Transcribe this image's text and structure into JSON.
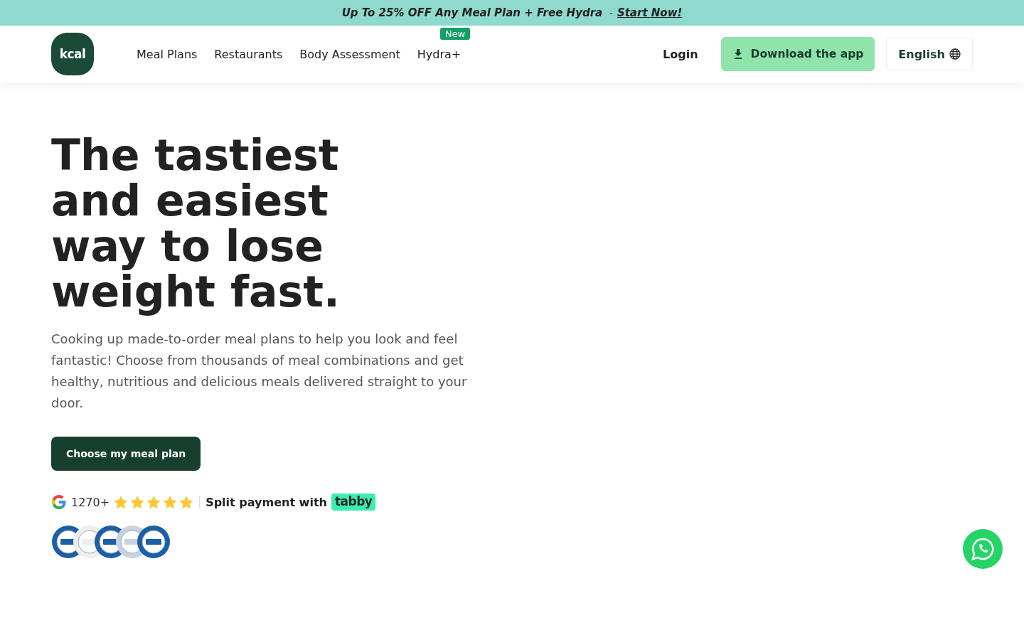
{
  "promo_bar": {
    "text": "Up To 25% OFF Any Meal Plan + Free Hydra",
    "separator": "-",
    "link": "Start Now!"
  },
  "header": {
    "logo": "kcal",
    "nav": [
      {
        "label": "Meal Plans"
      },
      {
        "label": "Restaurants"
      },
      {
        "label": "Body Assessment"
      },
      {
        "label": "Hydra+",
        "badge": "New"
      }
    ],
    "login": "Login",
    "download_button": "Download the app",
    "language_button": "English"
  },
  "hero": {
    "title": "The tastiest and easiest way to lose weight fast.",
    "description": "Cooking up made-to-order meal plans to help you look and feel fantastic! Choose from thousands of meal combinations and get healthy, nutritious and delicious meals delivered straight to your door.",
    "cta": "Choose my meal plan",
    "rating": {
      "count": "1270+",
      "stars": 5
    },
    "payment": {
      "text": "Split payment with",
      "brand": "tabby"
    },
    "certifications": [
      {
        "color": "#1a5fa8"
      },
      {
        "color": "#eeeeee"
      },
      {
        "color": "#1a5fa8"
      },
      {
        "color": "#c8d3e0"
      },
      {
        "color": "#1a5fa8"
      }
    ]
  }
}
